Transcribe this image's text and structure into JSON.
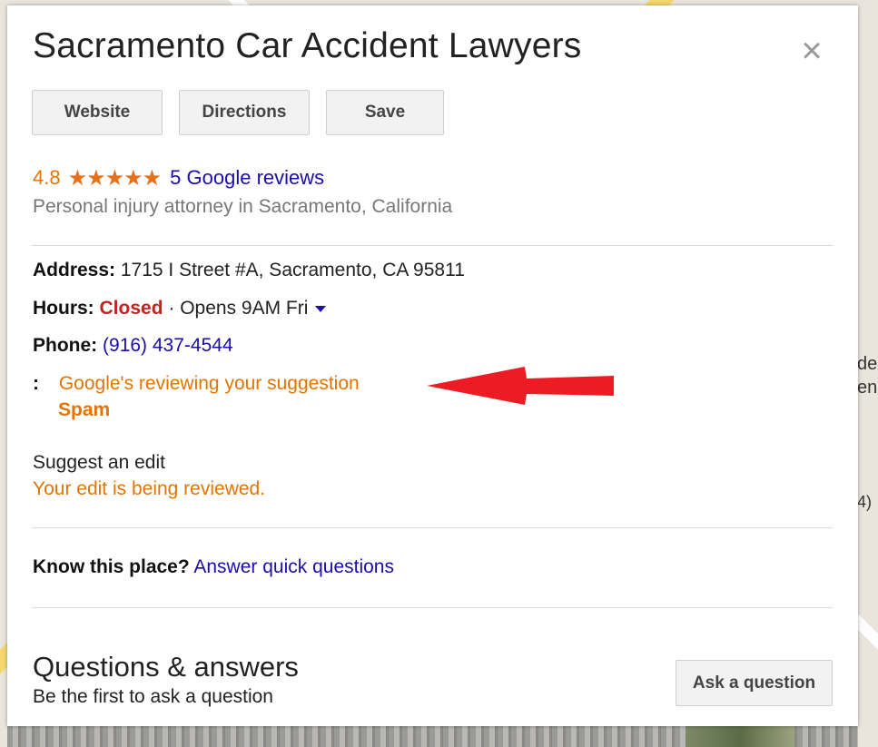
{
  "header": {
    "title": "Sacramento Car Accident Lawyers",
    "close_icon": "×"
  },
  "actions": {
    "website": "Website",
    "directions": "Directions",
    "save": "Save"
  },
  "rating": {
    "score": "4.8",
    "stars": "★★★★★",
    "stars_value": 5,
    "reviews_link": "5 Google reviews"
  },
  "category": "Personal injury attorney in Sacramento, California",
  "details": {
    "address_label": "Address:",
    "address_value": "1715 I Street #A, Sacramento, CA 95811",
    "hours_label": "Hours:",
    "hours_status": "Closed",
    "hours_next": "· Opens 9AM Fri",
    "phone_label": "Phone:",
    "phone_value": "(916) 437-4544",
    "suggestion_colon": ":",
    "suggestion_status": "Google's reviewing your suggestion",
    "suggestion_reason": "Spam"
  },
  "edit": {
    "suggest_link": "Suggest an edit",
    "edit_status": "Your edit is being reviewed."
  },
  "know": {
    "label": "Know this place?",
    "link": "Answer quick questions"
  },
  "qa": {
    "title": "Questions & answers",
    "first_link": "Be the first to ask a question",
    "ask_button": "Ask a question"
  },
  "map": {
    "label_line1": "de",
    "label_line2": "en",
    "label_badge": "4)"
  },
  "colors": {
    "accent_link": "#1a0dab",
    "orange": "#e37400",
    "closed_red": "#c5221f",
    "arrow_red": "#ed1c24"
  }
}
